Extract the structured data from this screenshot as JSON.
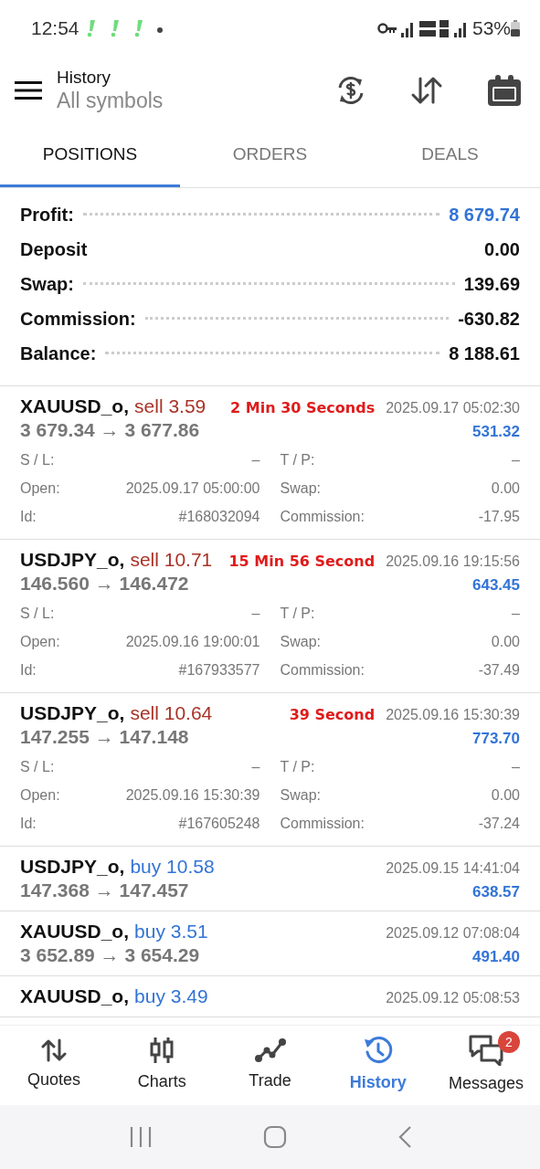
{
  "status_bar": {
    "time": "12:54",
    "battery": "53%"
  },
  "header": {
    "title": "History",
    "subtitle": "All symbols"
  },
  "tabs": [
    {
      "label": "POSITIONS",
      "selected": true
    },
    {
      "label": "ORDERS",
      "selected": false
    },
    {
      "label": "DEALS",
      "selected": false
    }
  ],
  "summary": [
    {
      "label": "Profit:",
      "value": "8 679.74",
      "leader": true,
      "kind": "profit"
    },
    {
      "label": "Deposit",
      "value": "0.00",
      "leader": false,
      "kind": "plain"
    },
    {
      "label": "Swap:",
      "value": "139.69",
      "leader": true,
      "kind": "plain"
    },
    {
      "label": "Commission:",
      "value": "-630.82",
      "leader": true,
      "kind": "plain"
    },
    {
      "label": "Balance:",
      "value": "8 188.61",
      "leader": true,
      "kind": "plain"
    }
  ],
  "positions": [
    {
      "symbol": "XAUUSD_o,",
      "kind": "sell",
      "trade": "sell 3.59",
      "note": "2 Min 30 Seconds",
      "time": "2025.09.17 05:02:30",
      "prices": "3 679.34 → 3 677.86",
      "profit": "531.32",
      "details": [
        {
          "label": "S / L:",
          "value": "–"
        },
        {
          "label": "T / P:",
          "value": "–"
        },
        {
          "label": "Open:",
          "value": "2025.09.17 05:00:00"
        },
        {
          "label": "Swap:",
          "value": "0.00"
        },
        {
          "label": "Id:",
          "value": "#168032094"
        },
        {
          "label": "Commission:",
          "value": "-17.95"
        }
      ]
    },
    {
      "symbol": "USDJPY_o,",
      "kind": "sell",
      "trade": "sell 10.71",
      "note": "15 Min 56 Second",
      "time": "2025.09.16 19:15:56",
      "prices": "146.560 → 146.472",
      "profit": "643.45",
      "details": [
        {
          "label": "S / L:",
          "value": "–"
        },
        {
          "label": "T / P:",
          "value": "–"
        },
        {
          "label": "Open:",
          "value": "2025.09.16 19:00:01"
        },
        {
          "label": "Swap:",
          "value": "0.00"
        },
        {
          "label": "Id:",
          "value": "#167933577"
        },
        {
          "label": "Commission:",
          "value": "-37.49"
        }
      ]
    },
    {
      "symbol": "USDJPY_o,",
      "kind": "sell",
      "trade": "sell 10.64",
      "note": "39 Second",
      "time": "2025.09.16 15:30:39",
      "prices": "147.255 → 147.148",
      "profit": "773.70",
      "details": [
        {
          "label": "S / L:",
          "value": "–"
        },
        {
          "label": "T / P:",
          "value": "–"
        },
        {
          "label": "Open:",
          "value": "2025.09.16 15:30:39"
        },
        {
          "label": "Swap:",
          "value": "0.00"
        },
        {
          "label": "Id:",
          "value": "#167605248"
        },
        {
          "label": "Commission:",
          "value": "-37.24"
        }
      ]
    },
    {
      "symbol": "USDJPY_o,",
      "kind": "buy",
      "trade": "buy 10.58",
      "time": "2025.09.15 14:41:04",
      "prices": "147.368 → 147.457",
      "profit": "638.57"
    },
    {
      "symbol": "XAUUSD_o,",
      "kind": "buy",
      "trade": "buy 3.51",
      "time": "2025.09.12 07:08:04",
      "prices": "3 652.89 → 3 654.29",
      "profit": "491.40"
    },
    {
      "symbol": "XAUUSD_o,",
      "kind": "buy",
      "trade": "buy 3.49",
      "time": "2025.09.12 05:08:53"
    }
  ],
  "bottom_nav": [
    {
      "label": "Quotes",
      "selected": false
    },
    {
      "label": "Charts",
      "selected": false
    },
    {
      "label": "Trade",
      "selected": false
    },
    {
      "label": "History",
      "selected": true
    },
    {
      "label": "Messages",
      "selected": false,
      "badge": "2"
    }
  ]
}
